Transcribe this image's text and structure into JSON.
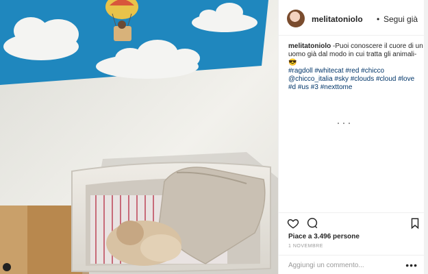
{
  "post": {
    "username": "melitatoniolo",
    "separator": "•",
    "follow_label": "Segui già",
    "caption_user": "melitatoniolo",
    "caption_text": "-Puoi conoscere il cuore di un uomo già dal modo in cui tratta gli animali-",
    "caption_emoji": "😎",
    "hashtags": "#ragdoll #whitecat #red #chicco @chicco_italia #sky #clouds #cloud #love #d #us #3 #nexttome",
    "likes": "Piace a 3.496 persone",
    "date": "1 NOVEMBRE",
    "comment_placeholder": "Aggiungi un commento...",
    "more_label": "•••"
  },
  "icons": {
    "like": "heart-icon",
    "comment": "comment-icon",
    "save": "bookmark-icon",
    "settings": "gear-icon"
  },
  "colors": {
    "wall_panel": "#1f87be",
    "hashtag": "#003569",
    "text": "#262626",
    "muted": "#999999"
  }
}
